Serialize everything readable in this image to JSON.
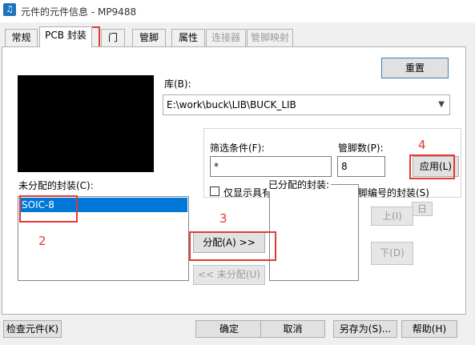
{
  "window": {
    "title": "元件的元件信息 - MP9488",
    "icon": "music-note-icon"
  },
  "tabs": [
    {
      "label": "常规",
      "state": "normal"
    },
    {
      "label": "PCB 封装",
      "state": "active"
    },
    {
      "label": "门",
      "state": "normal"
    },
    {
      "label": "管脚",
      "state": "normal"
    },
    {
      "label": "属性",
      "state": "normal"
    },
    {
      "label": "连接器",
      "state": "disabled"
    },
    {
      "label": "管脚映射",
      "state": "disabled"
    }
  ],
  "buttons": {
    "reset": "重置",
    "apply": "应用(L)",
    "assign": "分配(A) >>",
    "unassign": "<< 未分配(U)",
    "up": "上(I)",
    "down": "下(D)",
    "check": "检查元件(K)",
    "ok": "确定",
    "cancel": "取消",
    "saveas": "另存为(S)...",
    "help": "帮助(H)",
    "hidden": "日"
  },
  "library": {
    "label": "库(B):",
    "value": "E:\\work\\buck\\LIB\\BUCK_LIB"
  },
  "filter": {
    "label": "筛选条件(F):",
    "value": "*",
    "pin_count_label": "管脚数(P):",
    "pin_count_value": "8",
    "checkbox_label": "仅显示具有与元件类型匹配的管脚编号的封装(S)",
    "checked": false
  },
  "unassigned": {
    "label": "未分配的封装(C):",
    "items": [
      "SOIC-8"
    ]
  },
  "assigned": {
    "label": "已分配的封装:"
  },
  "annotations": [
    "1",
    "2",
    "3",
    "4"
  ],
  "colors": {
    "selection": "#0078d7",
    "annotation": "#e53935"
  }
}
